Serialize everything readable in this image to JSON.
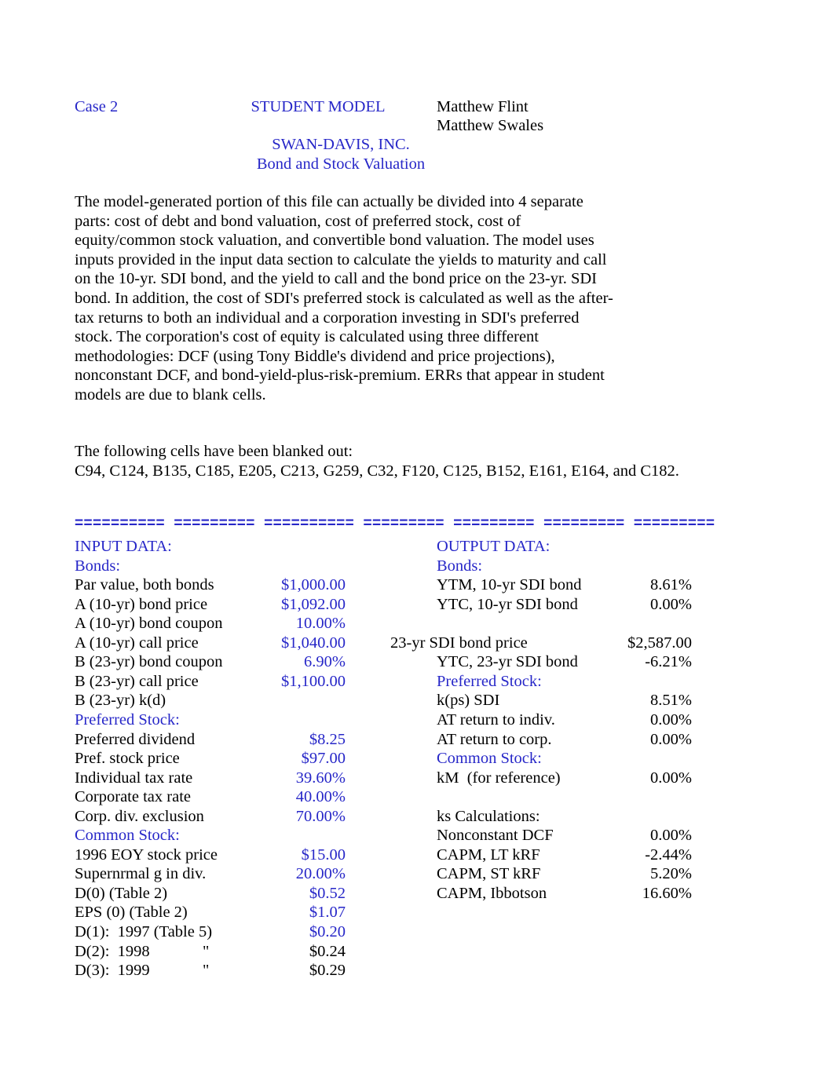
{
  "header": {
    "case_label": "Case 2",
    "model_label": "STUDENT MODEL",
    "author_1": "Matthew Flint",
    "author_2": "Matthew Swales",
    "company": "SWAN-DAVIS, INC.",
    "subtitle": "Bond and Stock Valuation"
  },
  "description": "The model-generated portion of this file can actually be divided into 4 separate parts: cost of debt and bond valuation, cost of preferred stock, cost of equity/common stock valuation, and convertible bond valuation. The model uses inputs provided in the input data section to calculate the yields to maturity and call on the 10-yr. SDI bond, and the yield to call and the bond price on the 23-yr. SDI bond.  In addition, the cost of SDI's preferred stock is calculated as well as the after-tax returns to both an individual and a corporation investing in SDI's preferred stock.  The corporation's cost of equity is calculated using three different methodologies:  DCF (using Tony Biddle's dividend and price projections), nonconstant DCF, and  bond-yield-plus-risk-premium.  ERRs that appear in student models are due to blank cells.",
  "blanked": {
    "intro": "The following cells have been blanked out:",
    "cells": "C94, C124, B135, C185, E205, C213, G259, C32, F120, C125, B152, E161, E164, and C182."
  },
  "separator": "==========  =========  ==========  =========  =========  =========  =========",
  "input_section": {
    "title": "INPUT DATA:",
    "groups": [
      {
        "heading": "Bonds:",
        "rows": [
          {
            "label": "Par value, both bonds",
            "value": "$1,000.00"
          },
          {
            "label": "A (10-yr) bond price",
            "value": "$1,092.00"
          },
          {
            "label": "A (10-yr) bond coupon",
            "value": "10.00%"
          },
          {
            "label": "A (10-yr) call price",
            "value": "$1,040.00"
          },
          {
            "label": "B (23-yr) bond coupon",
            "value": "6.90%"
          },
          {
            "label": "B (23-yr) call price",
            "value": "$1,100.00"
          },
          {
            "label": "B (23-yr) k(d)",
            "value": ""
          }
        ]
      },
      {
        "heading": "Preferred Stock:",
        "rows": [
          {
            "label": "Preferred dividend",
            "value": "$8.25"
          },
          {
            "label": "Pref. stock price",
            "value": "$97.00"
          },
          {
            "label": "Individual tax rate",
            "value": "39.60%"
          },
          {
            "label": "Corporate tax rate",
            "value": "40.00%"
          },
          {
            "label": "Corp. div. exclusion",
            "value": "70.00%"
          }
        ]
      },
      {
        "heading": "Common Stock:",
        "rows": [
          {
            "label": "1996 EOY stock price",
            "value": "$15.00"
          },
          {
            "label": "Supernrmal g in div.",
            "value": "20.00%"
          },
          {
            "label": "D(0) (Table 2)",
            "value": "$0.52"
          },
          {
            "label": "EPS (0) (Table 2)",
            "value": "$1.07"
          },
          {
            "label": "D(1):  1997 (Table 5)",
            "value": "$0.20"
          },
          {
            "label": "D(2):  1998",
            "mark": "\"",
            "value": "$0.24"
          },
          {
            "label": "D(3):  1999",
            "mark": "\"",
            "value": "$0.29"
          }
        ]
      }
    ]
  },
  "output_section": {
    "title": "OUTPUT DATA:",
    "groups": [
      {
        "heading": "Bonds:",
        "rows": [
          {
            "label": "YTM, 10-yr SDI bond",
            "value": "8.61%"
          },
          {
            "label": "YTC, 10-yr SDI bond",
            "value": "0.00%"
          },
          {
            "label": "",
            "value": ""
          },
          {
            "label": "23-yr SDI bond price",
            "value": "$2,587.00",
            "outdent": true
          },
          {
            "label": "YTC, 23-yr SDI bond",
            "value": "-6.21%"
          }
        ]
      },
      {
        "heading": "Preferred Stock:",
        "rows": [
          {
            "label": "k(ps) SDI",
            "value": "8.51%"
          },
          {
            "label": "AT return to indiv.",
            "value": "0.00%"
          },
          {
            "label": "AT return to corp.",
            "value": "0.00%"
          }
        ]
      },
      {
        "heading": "Common Stock:",
        "rows": [
          {
            "label": "kM  (for reference)",
            "value": "0.00%"
          },
          {
            "label": "",
            "value": ""
          },
          {
            "label": "ks Calculations:",
            "value": ""
          },
          {
            "label": "Nonconstant DCF",
            "value": "0.00%"
          },
          {
            "label": "CAPM, LT kRF",
            "value": "-2.44%"
          },
          {
            "label": "CAPM, ST kRF",
            "value": "5.20%"
          },
          {
            "label": "CAPM, Ibbotson",
            "value": "16.60%"
          }
        ]
      }
    ]
  },
  "colors": {
    "accent_blue": "#2727c8",
    "text_black": "#000000",
    "page_background": "#ffffff"
  }
}
